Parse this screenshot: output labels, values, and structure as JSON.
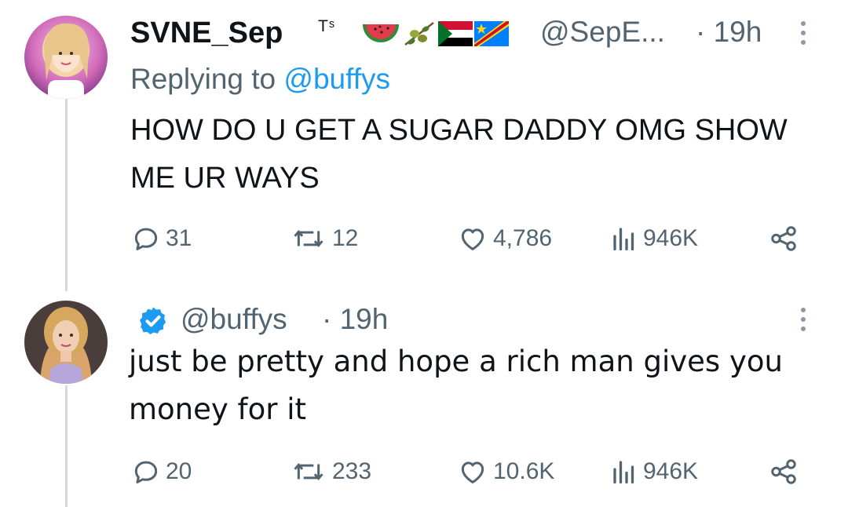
{
  "thread": [
    {
      "author_name": "SVNE_Sep",
      "author_suffix": "Tˢ",
      "emoji_flags": [
        "watermelon",
        "olive-branch",
        "sudan-flag",
        "drc-flag"
      ],
      "handle": "@SepE...",
      "time": "· 19h",
      "replying_to_label": "Replying to",
      "replying_to_mention": "@buffys",
      "text": "HOW DO U GET A SUGAR DADDY OMG SHOW ME UR WAYS",
      "stats": {
        "replies": "31",
        "reposts": "12",
        "likes": "4,786",
        "views": "946K"
      }
    },
    {
      "verified": true,
      "handle": "@buffys",
      "time": "· 19h",
      "text": "just be pretty and hope a rich man gives you money for it",
      "stats": {
        "replies": "20",
        "reposts": "233",
        "likes": "10.6K",
        "views": "946K"
      }
    }
  ],
  "colors": {
    "text_primary": "#0f1419",
    "text_secondary": "#536471",
    "link": "#1d9bf0",
    "thread_line": "#cfd9de",
    "verified_badge": "#1d9bf0"
  },
  "icons": [
    "reply-icon",
    "repost-icon",
    "like-icon",
    "views-icon",
    "share-icon",
    "more-icon",
    "verified-icon"
  ]
}
